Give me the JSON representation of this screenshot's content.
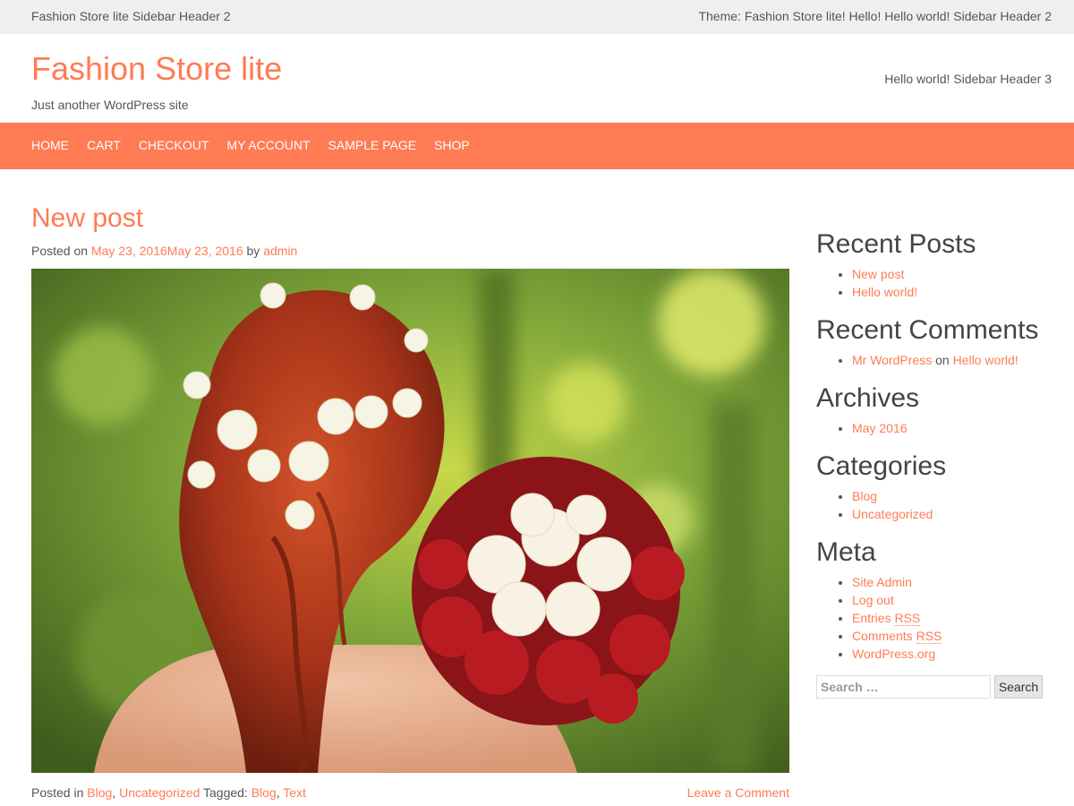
{
  "topbar": {
    "left_text": "Fashion Store lite Sidebar Header 2",
    "right_text": "Theme: Fashion Store lite! Hello! Hello world! Sidebar Header 2"
  },
  "header": {
    "site_title": "Fashion Store lite",
    "tagline": "Just another WordPress site",
    "right_text": "Hello world! Sidebar Header 3"
  },
  "nav": {
    "items": [
      "HOME",
      "CART",
      "CHECKOUT",
      "MY ACCOUNT",
      "SAMPLE PAGE",
      "SHOP"
    ]
  },
  "post": {
    "title": "New post",
    "posted_on_label": "Posted on",
    "date_link": "May 23, 2016May 23, 2016",
    "by_label": "by",
    "author": "admin",
    "posted_in_label": "Posted in",
    "category_1": "Blog",
    "category_2": "Uncategorized",
    "tagged_label": "Tagged:",
    "tag_1": "Blog",
    "tag_2": "Text",
    "leave_comment": "Leave a Comment"
  },
  "sidebar": {
    "recent_posts": {
      "title": "Recent Posts",
      "items": [
        "New post",
        "Hello world!"
      ]
    },
    "recent_comments": {
      "title": "Recent Comments",
      "author": "Mr WordPress",
      "on_label": "on",
      "post": "Hello world!"
    },
    "archives": {
      "title": "Archives",
      "items": [
        "May 2016"
      ]
    },
    "categories": {
      "title": "Categories",
      "items": [
        "Blog",
        "Uncategorized"
      ]
    },
    "meta": {
      "title": "Meta",
      "site_admin": "Site Admin",
      "log_out": "Log out",
      "entries_prefix": "Entries ",
      "entries_abbr": "RSS",
      "comments_prefix": "Comments ",
      "comments_abbr": "RSS",
      "wordpress_org": "WordPress.org"
    },
    "search": {
      "placeholder": "Search …",
      "button_label": "Search"
    }
  },
  "colors": {
    "accent": "#ff7b54",
    "topbar_bg": "#efefef",
    "text": "#555555",
    "heading": "#444444"
  }
}
